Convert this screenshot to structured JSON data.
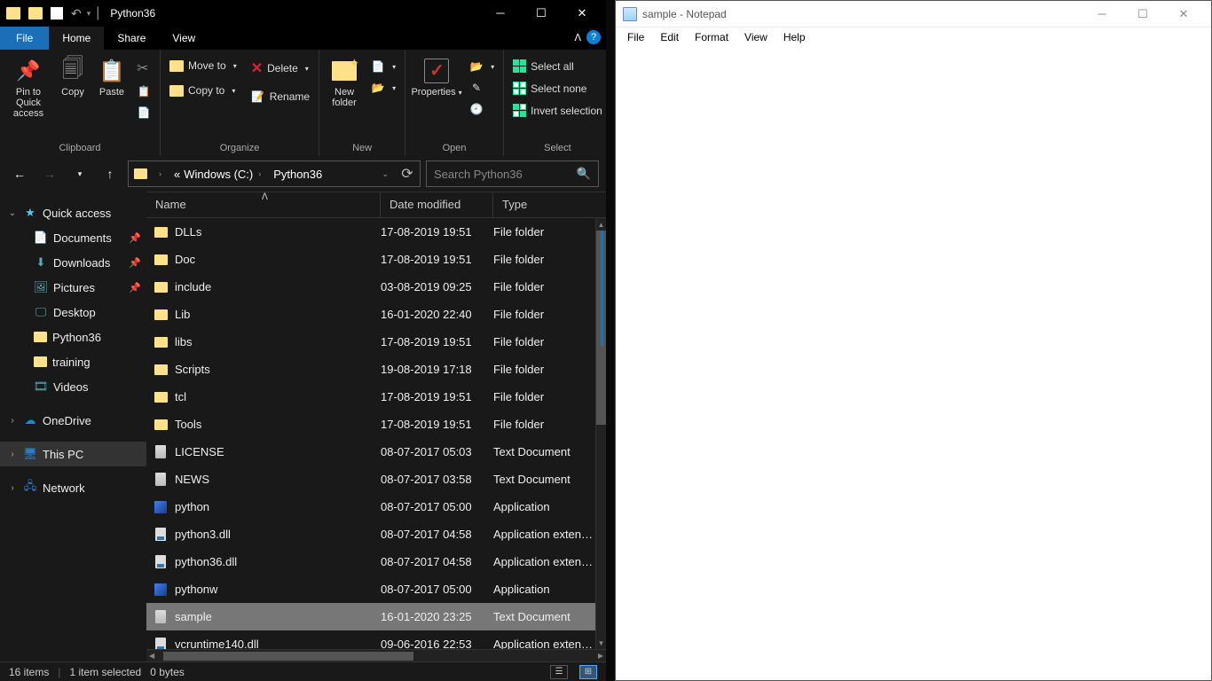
{
  "explorer": {
    "title": "Python36",
    "tabs": {
      "file": "File",
      "home": "Home",
      "share": "Share",
      "view": "View"
    },
    "ribbon": {
      "clipboard": {
        "label": "Clipboard",
        "pin": "Pin to Quick access",
        "copy": "Copy",
        "paste": "Paste"
      },
      "organize": {
        "label": "Organize",
        "move": "Move to",
        "copy": "Copy to",
        "delete": "Delete",
        "rename": "Rename"
      },
      "new": {
        "label": "New",
        "folder": "New folder"
      },
      "open": {
        "label": "Open",
        "props": "Properties"
      },
      "select": {
        "label": "Select",
        "all": "Select all",
        "none": "Select none",
        "invert": "Invert selection"
      }
    },
    "address": {
      "drive": "Windows (C:)",
      "folder": "Python36"
    },
    "search": {
      "placeholder": "Search Python36"
    },
    "nav": {
      "quick": "Quick access",
      "quick_items": [
        "Documents",
        "Downloads",
        "Pictures",
        "Desktop",
        "Python36",
        "training",
        "Videos"
      ],
      "onedrive": "OneDrive",
      "thispc": "This PC",
      "network": "Network"
    },
    "columns": {
      "name": "Name",
      "date": "Date modified",
      "type": "Type"
    },
    "files": [
      {
        "icon": "folder",
        "name": "DLLs",
        "date": "17-08-2019 19:51",
        "type": "File folder"
      },
      {
        "icon": "folder",
        "name": "Doc",
        "date": "17-08-2019 19:51",
        "type": "File folder"
      },
      {
        "icon": "folder",
        "name": "include",
        "date": "03-08-2019 09:25",
        "type": "File folder"
      },
      {
        "icon": "folder",
        "name": "Lib",
        "date": "16-01-2020 22:40",
        "type": "File folder"
      },
      {
        "icon": "folder",
        "name": "libs",
        "date": "17-08-2019 19:51",
        "type": "File folder"
      },
      {
        "icon": "folder",
        "name": "Scripts",
        "date": "19-08-2019 17:18",
        "type": "File folder"
      },
      {
        "icon": "folder",
        "name": "tcl",
        "date": "17-08-2019 19:51",
        "type": "File folder"
      },
      {
        "icon": "folder",
        "name": "Tools",
        "date": "17-08-2019 19:51",
        "type": "File folder"
      },
      {
        "icon": "doc",
        "name": "LICENSE",
        "date": "08-07-2017 05:03",
        "type": "Text Document"
      },
      {
        "icon": "doc",
        "name": "NEWS",
        "date": "08-07-2017 03:58",
        "type": "Text Document"
      },
      {
        "icon": "app",
        "name": "python",
        "date": "08-07-2017 05:00",
        "type": "Application"
      },
      {
        "icon": "dll",
        "name": "python3.dll",
        "date": "08-07-2017 04:58",
        "type": "Application exten…"
      },
      {
        "icon": "dll",
        "name": "python36.dll",
        "date": "08-07-2017 04:58",
        "type": "Application exten…"
      },
      {
        "icon": "app",
        "name": "pythonw",
        "date": "08-07-2017 05:00",
        "type": "Application"
      },
      {
        "icon": "doc",
        "name": "sample",
        "date": "16-01-2020 23:25",
        "type": "Text Document",
        "sel": true
      },
      {
        "icon": "dll",
        "name": "vcruntime140.dll",
        "date": "09-06-2016 22:53",
        "type": "Application exten…"
      }
    ],
    "status": {
      "count": "16 items",
      "sel": "1 item selected",
      "size": "0 bytes"
    }
  },
  "notepad": {
    "title": "sample - Notepad",
    "menu": [
      "File",
      "Edit",
      "Format",
      "View",
      "Help"
    ]
  }
}
